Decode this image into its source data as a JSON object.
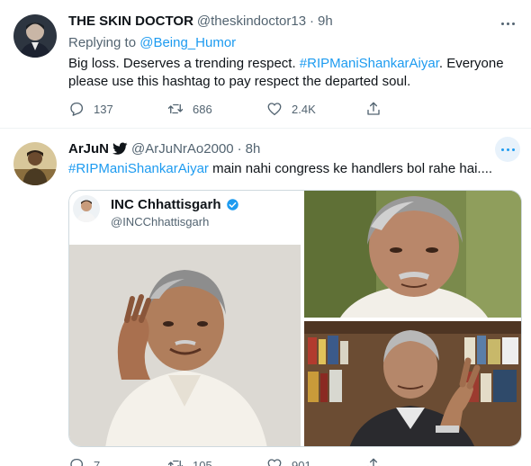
{
  "tweets": [
    {
      "name": "THE SKIN DOCTOR",
      "handle": "@theskindoctor13",
      "dot": "·",
      "time": "9h",
      "reply_prefix": "Replying to",
      "reply_to": "@Being_Humor",
      "text_pre": "Big loss. Deserves a trending respect. ",
      "hashtag": "#RIPManiShankarAiyar",
      "text_post": ". Everyone please use this hashtag to pay respect the departed soul.",
      "replies": "137",
      "retweets": "686",
      "likes": "2.4K"
    },
    {
      "name": "ArJuN",
      "handle": "@ArJuNrAo2000",
      "dot": "·",
      "time": "8h",
      "hashtag": "#RIPManiShankarAiyar",
      "text_post": " main nahi congress ke handlers bol rahe hai....",
      "replies": "7",
      "retweets": "105",
      "likes": "901"
    }
  ],
  "embedded": {
    "name": "INC Chhattisgarh",
    "handle": "@INCChhattisgarh"
  },
  "colors": {
    "accent": "#1d9bf0",
    "secondary_text": "#536471",
    "primary_text": "#0f1419"
  },
  "icons": [
    "reply-icon",
    "retweet-icon",
    "like-icon",
    "share-icon",
    "more-icon",
    "verified-icon",
    "bird-icon"
  ]
}
